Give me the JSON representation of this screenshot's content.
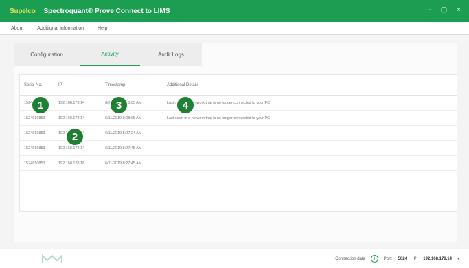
{
  "window": {
    "brand": "Supelco",
    "title": "Spectroquant® Prove Connect to LIMS",
    "controls": [
      "-",
      "▢",
      "×"
    ]
  },
  "menu": [
    "About",
    "Additional Information",
    "Help"
  ],
  "tabs": [
    {
      "label": "Configuration",
      "active": false
    },
    {
      "label": "Activity",
      "active": true
    },
    {
      "label": "Audit Logs",
      "active": false
    }
  ],
  "table": {
    "headers": [
      "Serial No.",
      "IP",
      "Timestamp",
      "Additional Details"
    ],
    "rows": [
      {
        "serial": "1524610853",
        "ip": "192.168.178.14",
        "timestamp": "6/11/2019 8:08:05 AM",
        "details": "Last seen in a network that is no longer connected to your PC"
      },
      {
        "serial": "1524610853",
        "ip": "192.168.178.14",
        "timestamp": "6/11/2019 8:08:05 AM",
        "details": "Last seen in a network that is no longer connected to your PC"
      },
      {
        "serial": "1524610853",
        "ip": "192.168.178.18",
        "timestamp": "6/11/2019 8:27:24 AM",
        "details": ""
      },
      {
        "serial": "1524610853",
        "ip": "192.168.178.14",
        "timestamp": "6/11/2019 8:27:45 AM",
        "details": ""
      },
      {
        "serial": "1524610853",
        "ip": "192.168.178.18",
        "timestamp": "6/11/2019 8:27:45 AM",
        "details": ""
      }
    ]
  },
  "markers": [
    "1",
    "2",
    "3",
    "4"
  ],
  "status": {
    "connection_label": "Connection data",
    "port_label": "Port:",
    "port_value": "5024",
    "ip_label": "IP:",
    "ip_value": "192.168.178.14"
  },
  "colors": {
    "accent": "#1c9e52",
    "marker": "#1f7f32",
    "brand_text": "#e8e35a"
  }
}
